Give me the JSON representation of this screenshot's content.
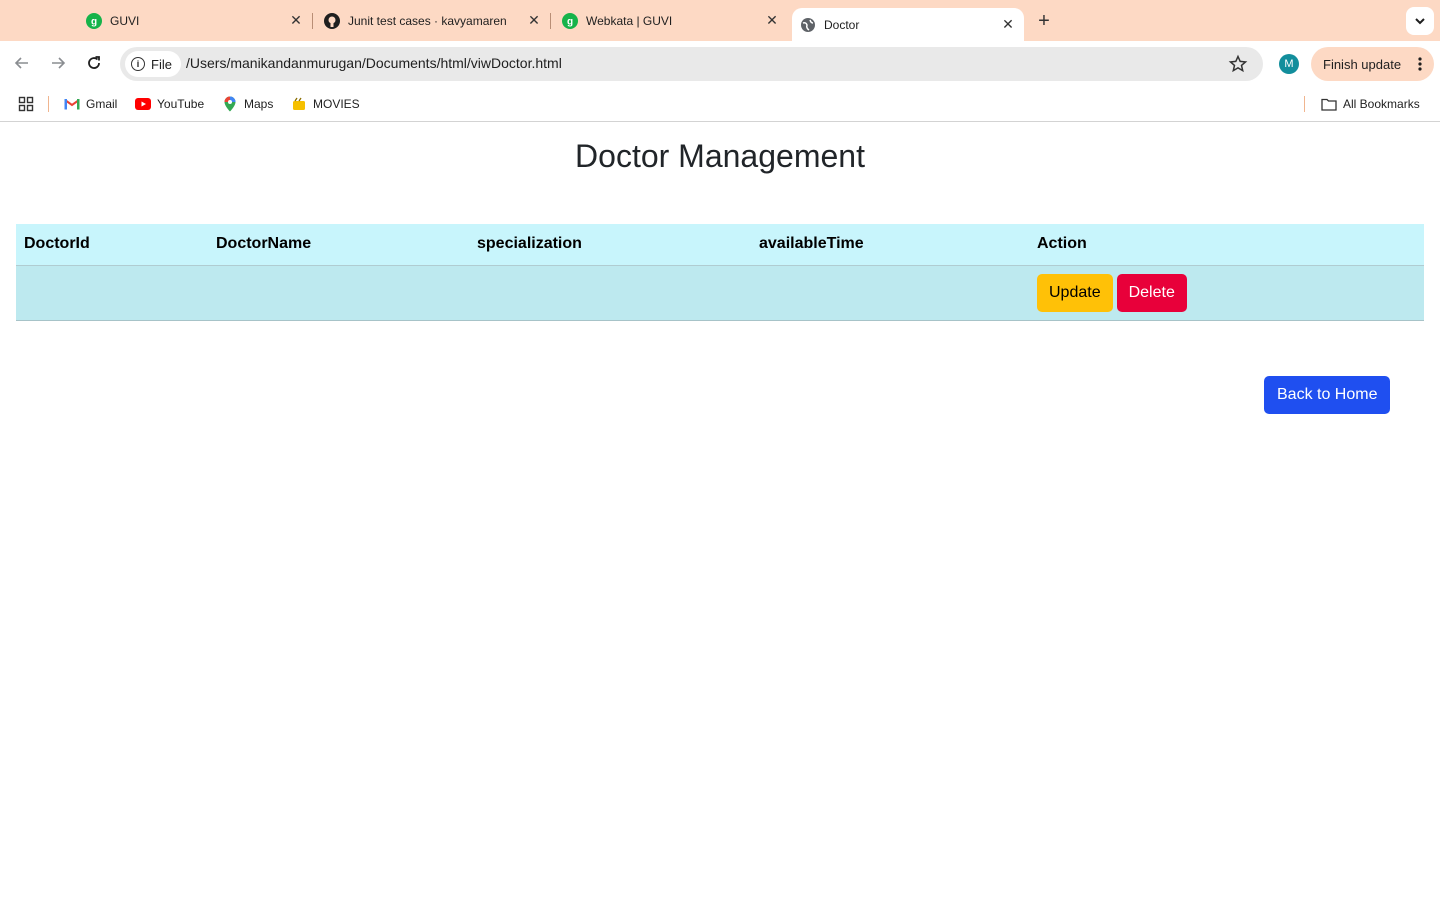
{
  "browser": {
    "tabs": [
      {
        "title": "GUVI",
        "icon": "guvi-icon"
      },
      {
        "title": "Junit test cases · kavyamaren",
        "icon": "github-icon"
      },
      {
        "title": "Webkata | GUVI",
        "icon": "guvi-icon"
      },
      {
        "title": "Doctor",
        "icon": "globe-icon"
      }
    ],
    "address_chip": "File",
    "url": "/Users/manikandanmurugan/Documents/html/viwDoctor.html",
    "avatar_letter": "M",
    "finish_update": "Finish update",
    "bookmarks": [
      {
        "label": "Gmail",
        "icon": "gmail-icon"
      },
      {
        "label": "YouTube",
        "icon": "youtube-icon"
      },
      {
        "label": "Maps",
        "icon": "maps-icon"
      },
      {
        "label": "MOVIES",
        "icon": "movies-icon"
      }
    ],
    "all_bookmarks": "All Bookmarks",
    "colors": {
      "tabstrip": "#fdd9c4",
      "accent_avatar": "#128e9c"
    }
  },
  "page": {
    "title": "Doctor Management",
    "table": {
      "headers": [
        "DoctorId",
        "DoctorName",
        "specialization",
        "availableTime",
        "Action"
      ],
      "rows": [
        {
          "doctor_id": "",
          "doctor_name": "",
          "specialization": "",
          "available_time": "",
          "update_label": "Update",
          "delete_label": "Delete"
        }
      ]
    },
    "back_home": "Back to Home",
    "colors": {
      "header_bg": "#c8f5fc",
      "row_bg": "#bde9ef",
      "update": "#ffc107",
      "delete": "#e8003a",
      "home": "#1f4ff0"
    }
  }
}
